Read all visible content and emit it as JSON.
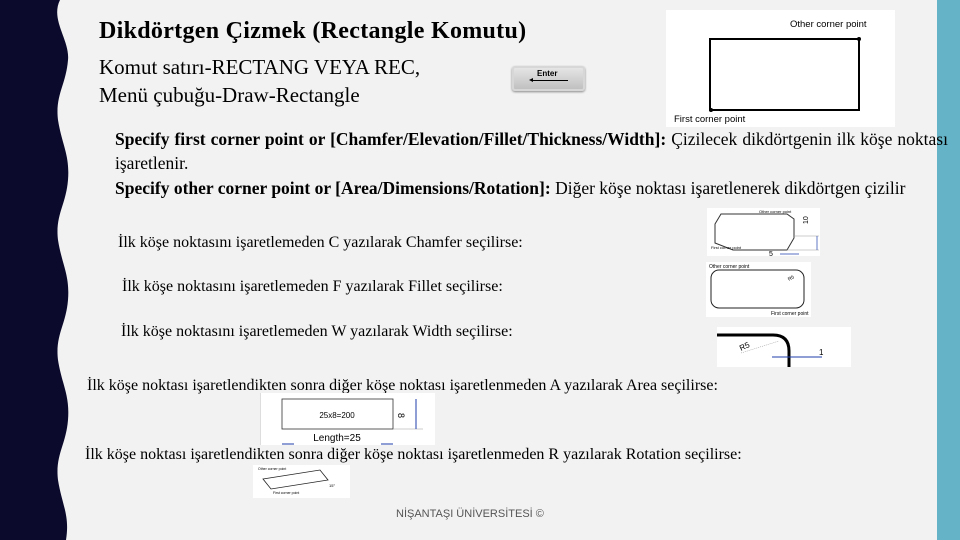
{
  "slide": {
    "title": "Dikdörtgen Çizmek (Rectangle Komutu)",
    "subtitle_lines": [
      "Komut satırı-RECTANG VEYA REC,",
      "Menü çubuğu-Draw-Rectangle"
    ],
    "enter_key_label": "Enter",
    "paragraphs": [
      {
        "bold": "Specify first corner point or [Chamfer/Elevation/Fillet/Thickness/Width]:",
        "text": " Çizilecek dikdörtgenin ilk köşe noktası işaretlenir."
      },
      {
        "bold": "Specify other corner point or [Area/Dimensions/Rotation]:",
        "text": " Diğer köşe noktası işaretlenerek dikdörtgen çizilir"
      }
    ],
    "options": [
      "İlk köşe noktasını işaretlemeden C yazılarak Chamfer seçilirse:",
      "İlk köşe noktasını işaretlemeden F  yazılarak Fillet seçilirse:",
      "İlk köşe noktasını işaretlemeden W yazılarak Width seçilirse:",
      "İlk köşe noktası işaretlendikten sonra diğer köşe noktası işaretlenmeden A yazılarak Area seçilirse:",
      "İlk köşe noktası işaretlendikten sonra diğer köşe noktası işaretlenmeden R yazılarak Rotation seçilirse:"
    ],
    "footer": "NİŞANTAŞI ÜNİVERSİTESİ ©"
  },
  "figures": {
    "rectangle": {
      "other_corner": "Other corner point",
      "first_corner": "First corner point"
    },
    "chamfer": {
      "other_corner": "Other corner point",
      "first_corner": "First corner point",
      "dim_vertical": "10",
      "dim_horizontal": "5"
    },
    "fillet": {
      "other_corner": "Other corner point",
      "first_corner": "First corner point",
      "radius": "R5"
    },
    "width": {
      "radius": "R5",
      "width": "1"
    },
    "area": {
      "area": "25x8=200",
      "length": "Length=25",
      "width": "8"
    },
    "rotation": {
      "other_corner": "Other corner point",
      "first_corner": "First corner point",
      "angle": "15°"
    }
  },
  "colors": {
    "left_band": "#0b0a2c",
    "right_band": "#64b3c7",
    "background": "#f2f2f2",
    "dimension_blue": "#1f3fae"
  }
}
